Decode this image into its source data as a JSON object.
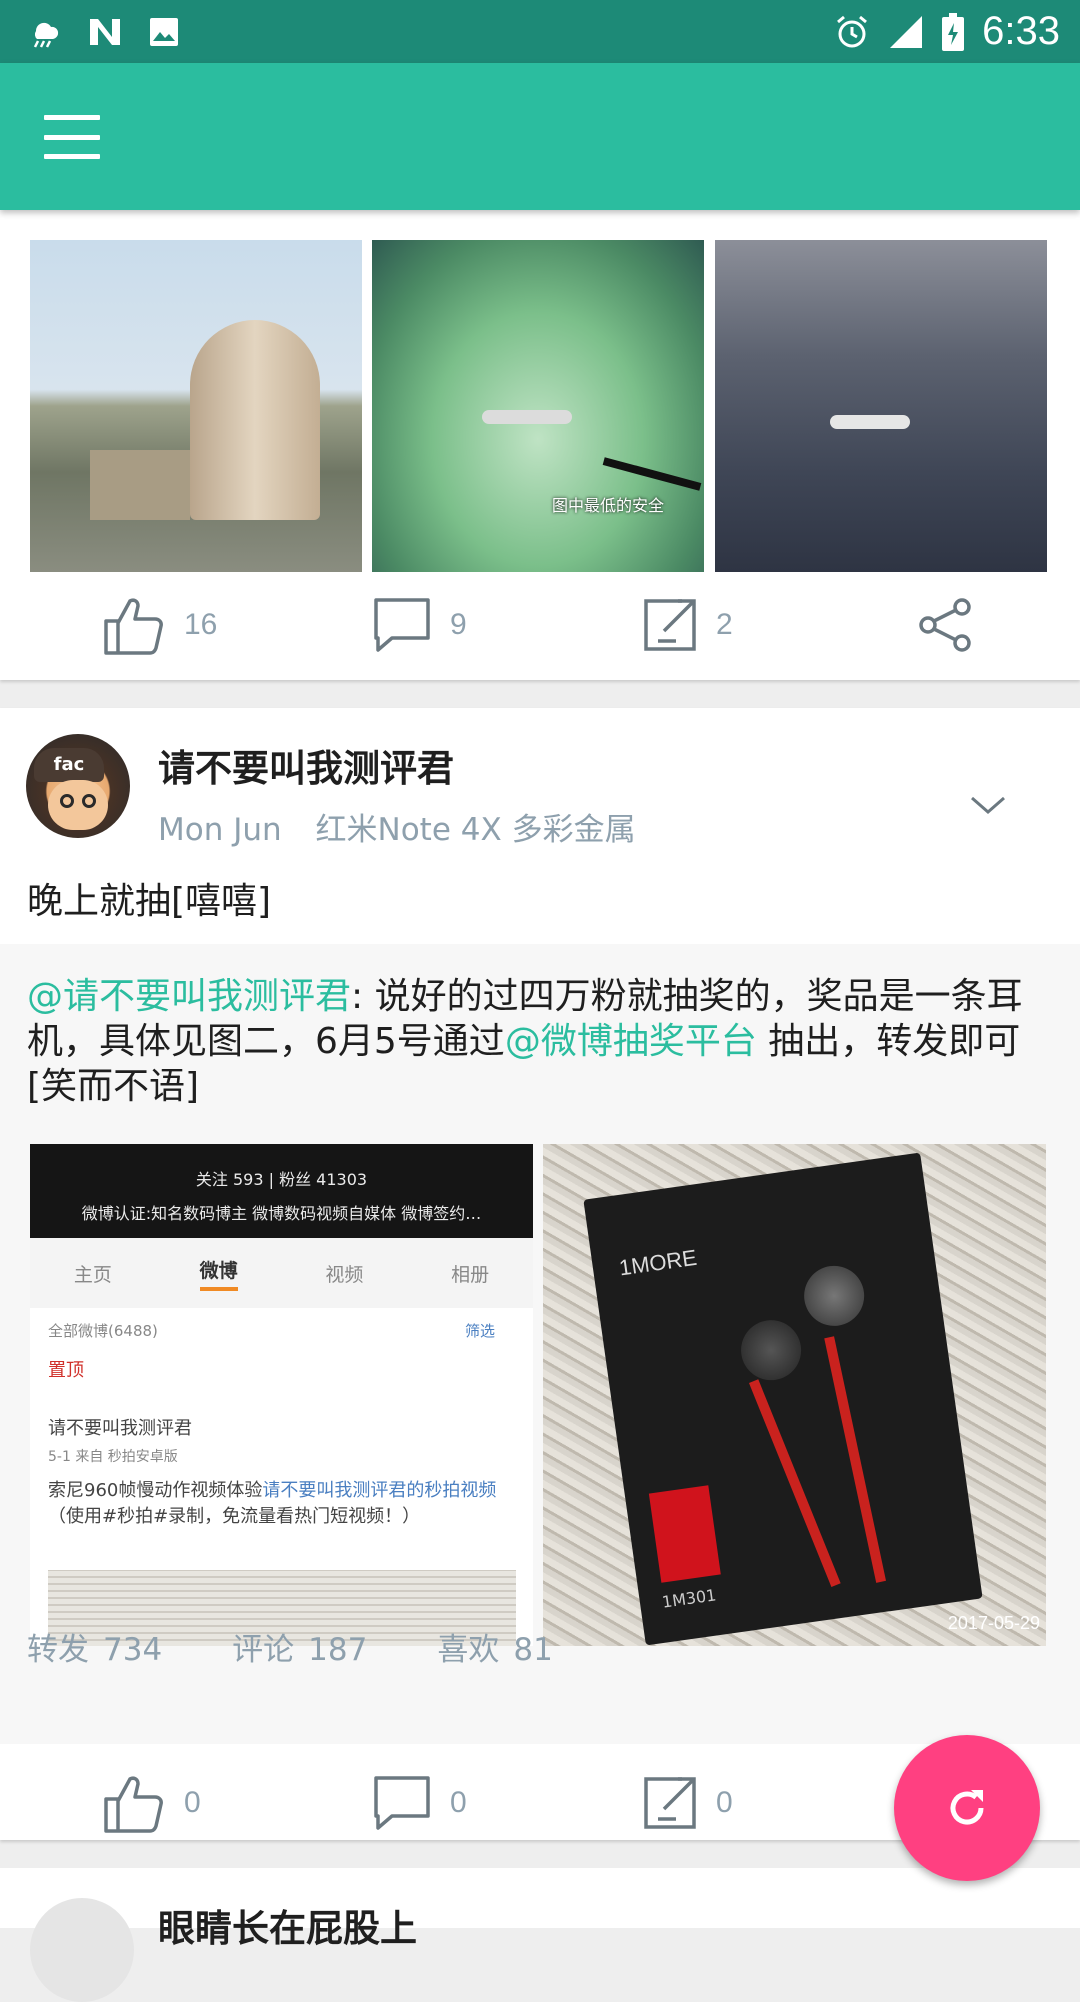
{
  "status_bar": {
    "time": "6:33",
    "icons": [
      "weather-rain-icon",
      "n-icon",
      "image-icon",
      "alarm-icon",
      "signal-icon",
      "battery-icon"
    ]
  },
  "toolbar": {
    "menu_icon": "hamburger-menu-icon"
  },
  "post_top": {
    "thumbnails": [
      "airport-radar-photo",
      "radar-coverage-diagram",
      "airplane-in-clouds-photo"
    ],
    "diagram_caption": "图中最低的安全",
    "actions": {
      "like": "16",
      "comment": "9",
      "repost": "2"
    }
  },
  "post": {
    "author": "请不要叫我测评君",
    "date": "Mon Jun",
    "device": "红米Note 4X 多彩金属",
    "text": "晚上就抽[嘻嘻]",
    "repost": {
      "mention": "@请不要叫我测评君",
      "text_part1": ": 说好的过四万粉就抽奖的，奖品是一条耳机，具体见图二，6月5号通过",
      "mention2": "@微博抽奖平台",
      "text_part2": "  抽出，转发即可[笑而不语]",
      "screenshot": {
        "follow_line": "关注 593  |  粉丝 41303",
        "verified_line": "微博认证:知名数码博主 微博数码视频自媒体 微博签约…",
        "tabs": [
          "主页",
          "微博",
          "视频",
          "相册"
        ],
        "active_tab": "微博",
        "all_posts": "全部微博(6488)",
        "filter": "筛选",
        "pinned": "置顶",
        "name_line": "请不要叫我测评君",
        "date_line": "5-1  来自 秒拍安卓版",
        "post_line1": "索尼960帧慢动作视频体验",
        "post_link": "请不要叫我测评君的秒拍视频",
        "post_line2": "（使用#秒拍#录制，免流量看热门短视频！）"
      },
      "product_photo": {
        "brand": "1MORE",
        "model": "1M301",
        "stamp": "2017-05-29"
      },
      "stats": [
        {
          "label": "转发",
          "value": "734"
        },
        {
          "label": "评论",
          "value": "187"
        },
        {
          "label": "喜欢",
          "value": "81"
        }
      ]
    },
    "actions": {
      "like": "0",
      "comment": "0",
      "repost": "0"
    }
  },
  "next_post": {
    "author": "眼睛长在屁股上"
  },
  "fab": {
    "icon": "refresh-icon"
  },
  "colors": {
    "primary": "#2bbd9f",
    "primary_dark": "#1d8a77",
    "accent": "#ff4081",
    "muted": "#8ea0ad"
  }
}
